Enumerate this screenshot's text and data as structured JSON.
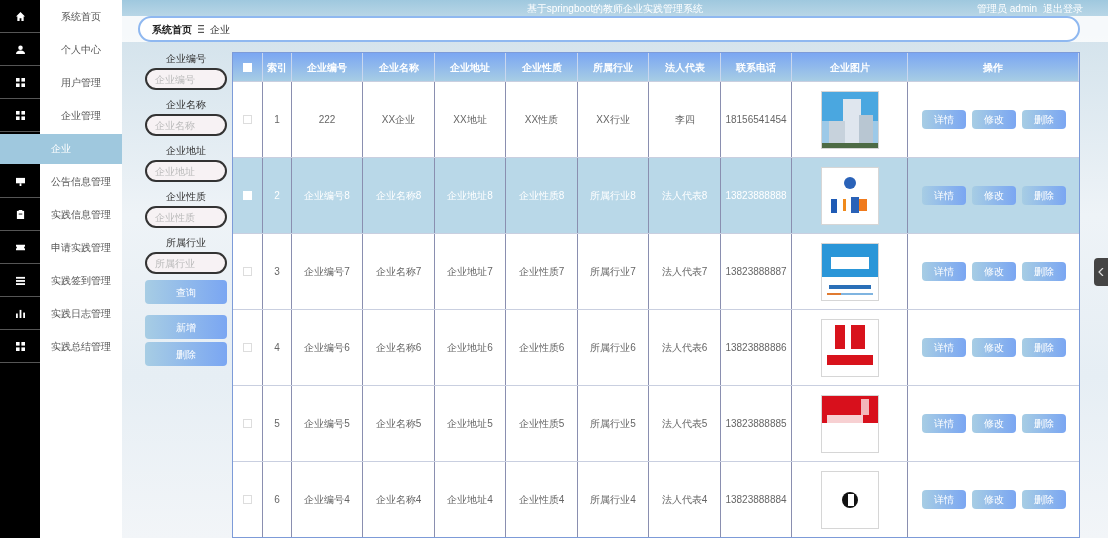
{
  "header": {
    "title": "基于springboot的教师企业实践管理系统",
    "user": "管理员 admin",
    "logout": "退出登录"
  },
  "sidebar": {
    "items": [
      {
        "label": "系统首页",
        "selected": false
      },
      {
        "label": "个人中心",
        "selected": false
      },
      {
        "label": "用户管理",
        "selected": false
      },
      {
        "label": "企业管理",
        "selected": false,
        "children": [
          {
            "label": "企业",
            "selected": true
          }
        ]
      },
      {
        "label": "公告信息管理",
        "selected": false
      },
      {
        "label": "实践信息管理",
        "selected": false
      },
      {
        "label": "申请实践管理",
        "selected": false
      },
      {
        "label": "实践签到管理",
        "selected": false
      },
      {
        "label": "实践日志管理",
        "selected": false
      },
      {
        "label": "实践总结管理",
        "selected": false
      }
    ]
  },
  "breadcrumb": [
    "系统首页",
    "企业"
  ],
  "search": {
    "fields": [
      {
        "label": "企业编号",
        "placeholder": "企业编号"
      },
      {
        "label": "企业名称",
        "placeholder": "企业名称"
      },
      {
        "label": "企业地址",
        "placeholder": "企业地址"
      },
      {
        "label": "企业性质",
        "placeholder": "企业性质"
      },
      {
        "label": "所属行业",
        "placeholder": "所属行业"
      }
    ],
    "query": "查询",
    "add": "新增",
    "delete": "删除"
  },
  "table": {
    "all_checked": false,
    "columns": [
      "索引",
      "企业编号",
      "企业名称",
      "企业地址",
      "企业性质",
      "所属行业",
      "法人代表",
      "联系电话",
      "企业图片",
      "操作"
    ],
    "rows": [
      {
        "selected": false,
        "checked": false,
        "cells": [
          "1",
          "222",
          "XX企业",
          "XX地址",
          "XX性质",
          "XX行业",
          "李四",
          "18156541454"
        ],
        "actions": [
          "详情",
          "修改",
          "删除"
        ]
      },
      {
        "selected": true,
        "checked": false,
        "cells": [
          "2",
          "企业编号8",
          "企业名称8",
          "企业地址8",
          "企业性质8",
          "所属行业8",
          "法人代表8",
          "13823888888"
        ],
        "actions": [
          "详情",
          "修改",
          "删除"
        ]
      },
      {
        "selected": false,
        "checked": false,
        "cells": [
          "3",
          "企业编号7",
          "企业名称7",
          "企业地址7",
          "企业性质7",
          "所属行业7",
          "法人代表7",
          "13823888887"
        ],
        "actions": [
          "详情",
          "修改",
          "删除"
        ]
      },
      {
        "selected": false,
        "checked": false,
        "cells": [
          "4",
          "企业编号6",
          "企业名称6",
          "企业地址6",
          "企业性质6",
          "所属行业6",
          "法人代表6",
          "13823888886"
        ],
        "actions": [
          "详情",
          "修改",
          "删除"
        ]
      },
      {
        "selected": false,
        "checked": false,
        "cells": [
          "5",
          "企业编号5",
          "企业名称5",
          "企业地址5",
          "企业性质5",
          "所属行业5",
          "法人代表5",
          "13823888885"
        ],
        "actions": [
          "详情",
          "修改",
          "删除"
        ]
      },
      {
        "selected": false,
        "checked": false,
        "cells": [
          "6",
          "企业编号4",
          "企业名称4",
          "企业地址4",
          "企业性质4",
          "所属行业4",
          "法人代表4",
          "13823888884"
        ],
        "actions": [
          "详情",
          "修改",
          "删除"
        ]
      }
    ]
  }
}
